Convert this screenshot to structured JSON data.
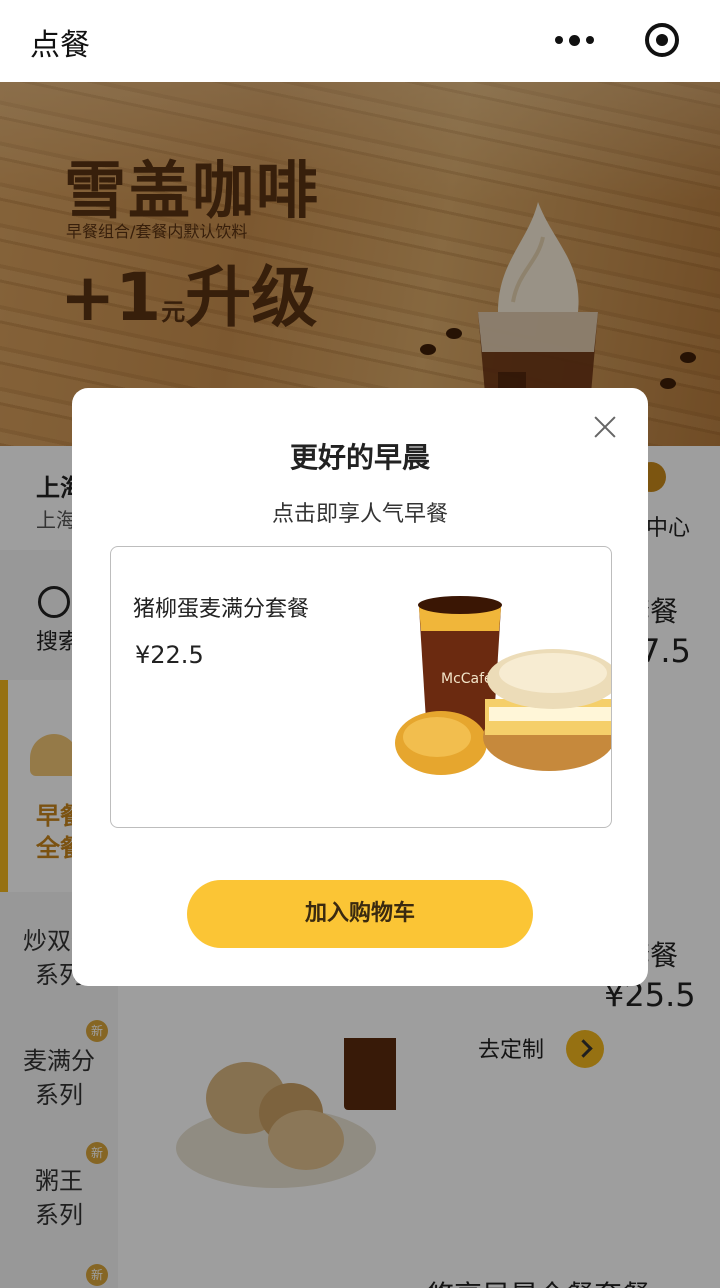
{
  "header": {
    "title": "点餐",
    "more_icon": "more-dots-icon",
    "close_icon": "target-circle-icon"
  },
  "banner": {
    "title": "雪盖咖啡",
    "subtitle": "早餐组合/套餐内默认饮料",
    "upgrade_plus": "+1",
    "upgrade_unit": "元",
    "upgrade_text": "升级"
  },
  "location": {
    "city": "上海",
    "city_sub": "上海",
    "member_center": "中心"
  },
  "sidebar": {
    "search_label": "搜索",
    "active_label_line1": "早餐",
    "active_label_line2": "全餐",
    "categories": [
      {
        "line1": "炒双蛋",
        "line2": "系列"
      },
      {
        "line1": "麦满分",
        "line2": "系列",
        "badge": "新"
      },
      {
        "line1": "粥王",
        "line2": "系列",
        "badge": "新"
      },
      {
        "badge": "新"
      }
    ]
  },
  "menu": {
    "card1_title": "套餐",
    "card1_price": "7.5",
    "card2_title": "套餐",
    "card2_price": "¥25.5",
    "customize_label": "去定制",
    "card3_title": "悠享早晨全餐套餐"
  },
  "modal": {
    "title": "更好的早晨",
    "subtitle": "点击即享人气早餐",
    "product_name": "猪柳蛋麦满分套餐",
    "product_price": "¥22.5",
    "add_button": "加入购物车",
    "cup_brand": "McCafé"
  },
  "colors": {
    "accent_yellow": "#fbc535",
    "brand_gold": "#f2b71e",
    "banner_text": "#5a3212"
  }
}
